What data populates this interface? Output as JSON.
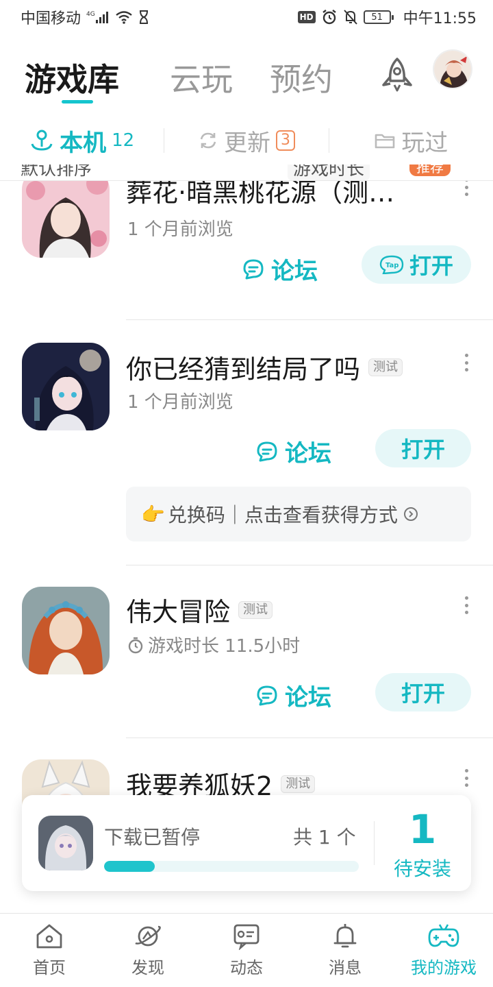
{
  "status_bar": {
    "carrier": "中国移动",
    "network": "4G",
    "hd": "HD",
    "battery": "51",
    "time": "中午11:55"
  },
  "header": {
    "tabs": [
      {
        "label": "游戏库",
        "active": true
      },
      {
        "label": "云玩",
        "active": false
      },
      {
        "label": "预约",
        "active": false
      }
    ]
  },
  "subtabs": {
    "local": {
      "label": "本机",
      "count": "12"
    },
    "update": {
      "label": "更新",
      "count": "3"
    },
    "played": {
      "label": "玩过"
    }
  },
  "sort_row": {
    "left": "默认排序",
    "right": "游戏时长",
    "badge": "推荐"
  },
  "games": [
    {
      "title": "葬花·暗黑桃花源（测…",
      "sub": "1 个月前浏览",
      "forum_label": "论坛",
      "open_label": "打开",
      "open_tap_badge": "Tap"
    },
    {
      "title": "你已经猜到结局了吗",
      "badge": "测试",
      "sub": "1 个月前浏览",
      "forum_label": "论坛",
      "open_label": "打开",
      "code_text": "兑换码｜点击查看获得方式"
    },
    {
      "title": "伟大冒险",
      "badge": "测试",
      "sub": "游戏时长 11.5小时",
      "forum_label": "论坛",
      "open_label": "打开"
    },
    {
      "title": "我要养狐妖2",
      "badge": "测试"
    }
  ],
  "download": {
    "status": "下载已暂停",
    "total": "共 1 个",
    "count": "1",
    "label": "待安装",
    "progress_fraction": 0.2
  },
  "bottom_nav": [
    {
      "label": "首页",
      "icon": "home-icon"
    },
    {
      "label": "发现",
      "icon": "planet-icon"
    },
    {
      "label": "动态",
      "icon": "feed-icon"
    },
    {
      "label": "消息",
      "icon": "bell-icon"
    },
    {
      "label": "我的游戏",
      "icon": "gamepad-icon",
      "active": true
    }
  ],
  "colors": {
    "accent": "#15b8c2",
    "update_badge": "#f08c5a"
  }
}
